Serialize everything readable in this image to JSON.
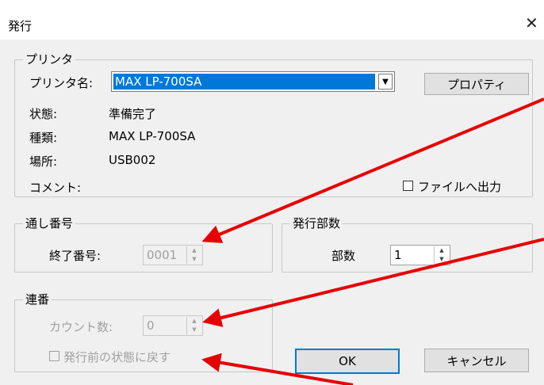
{
  "window": {
    "title": "発行"
  },
  "printer_group": {
    "legend": "プリンタ",
    "name_label": "プリンタ名:",
    "name_value": "MAX LP-700SA",
    "properties_button": "プロパティ",
    "status_label": "状態:",
    "status_value": "準備完了",
    "type_label": "種類:",
    "type_value": "MAX LP-700SA",
    "location_label": "場所:",
    "location_value": "USB002",
    "comment_label": "コメント:",
    "print_to_file_label": "ファイルへ出力"
  },
  "serial_group": {
    "legend": "通し番号",
    "end_label": "終了番号:",
    "end_value": "0001"
  },
  "copies_group": {
    "legend": "発行部数",
    "copies_label": "部数",
    "copies_value": "1"
  },
  "sequence_group": {
    "legend": "連番",
    "count_label": "カウント数:",
    "count_value": "0",
    "reset_label": "発行前の状態に戻す"
  },
  "buttons": {
    "ok": "OK",
    "cancel": "キャンセル"
  },
  "annotation_color": "#e60000"
}
